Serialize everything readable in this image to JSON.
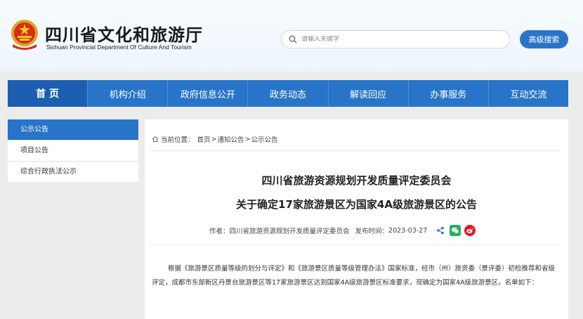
{
  "header": {
    "title": "四川省文化和旅游厅",
    "subtitle": "Sichuan Provincial Department Of Culture And Tourism",
    "search_placeholder": "请输入关键字",
    "advanced_search_label": "高级搜索"
  },
  "nav": {
    "items": [
      "首 页",
      "机构介绍",
      "政府信息公开",
      "政务动态",
      "解读回应",
      "办事服务",
      "互动交流"
    ]
  },
  "sidebar": {
    "items": [
      "公示公告",
      "项目公告",
      "综合行政执法公示"
    ]
  },
  "breadcrumb": {
    "prefix": "当前位置：",
    "items": [
      "首页",
      "通知公告",
      "公示公告"
    ],
    "separator": ">"
  },
  "article": {
    "title_line1": "四川省旅游资源规划开发质量评定委员会",
    "title_line2": "关于确定17家旅游景区为国家4A级旅游景区的公告",
    "author_label": "作者：",
    "author": "四川省旅游资源规划开发质量评定委员会",
    "time_label": "发布时间：",
    "time": "2023-03-27",
    "body": "根据《旅游景区质量等级的划分与评定》和《旅游景区质量等级管理办法》国家标准，经市（州）旅资委（景评委）初检推荐和省级评定，成都市东部新区丹景台旅游景区等17家旅游景区达到国家4A级旅游景区标准要求，现确定为国家4A级旅游景区。名单如下："
  },
  "colors": {
    "primary": "#2874c8",
    "nav_active": "#1c5fb0",
    "wechat": "#2aae67",
    "weibo": "#e6162d",
    "share": "#2a74c8"
  },
  "icons": [
    "national-emblem-icon",
    "search-icon",
    "home-icon",
    "share-icon",
    "wechat-icon",
    "weibo-icon"
  ]
}
